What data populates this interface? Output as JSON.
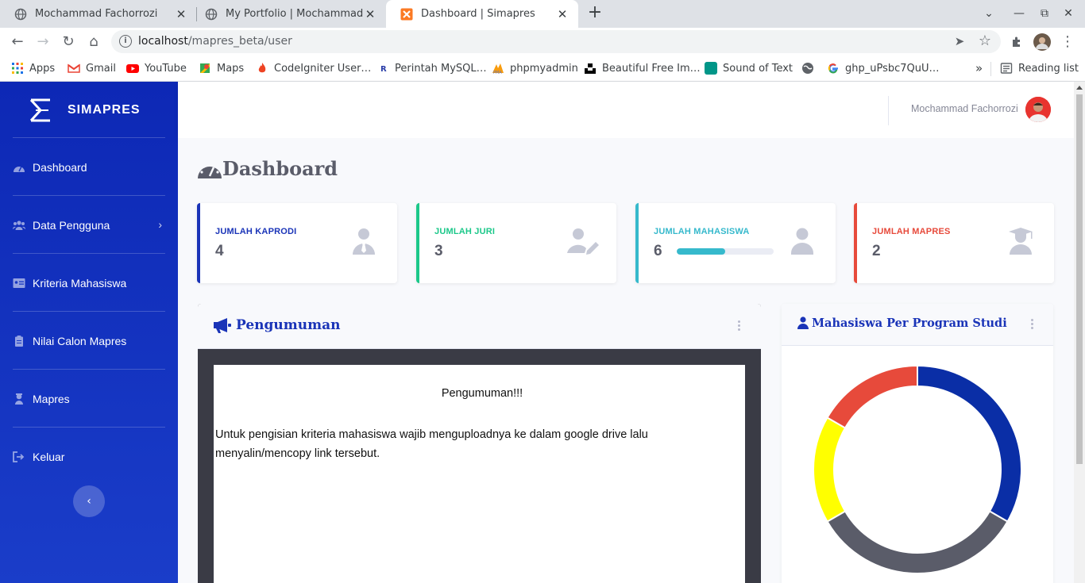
{
  "browser": {
    "tabs": [
      {
        "title": "Mochammad Fachorrozi",
        "active": false
      },
      {
        "title": "My Portfolio | Mochammad Fa",
        "active": false
      },
      {
        "title": "Dashboard | Simapres",
        "active": true
      }
    ],
    "url_host": "localhost",
    "url_path": "/mapres_beta/user",
    "bookmarks": [
      "Apps",
      "Gmail",
      "YouTube",
      "Maps",
      "CodeIgniter User…",
      "Perintah MySQL…",
      "phpmyadmin",
      "Beautiful Free Im…",
      "Sound of Text",
      "ghp_uPsbc7QuU…"
    ],
    "reading_list": "Reading list",
    "more_bookmarks": "»"
  },
  "sidebar": {
    "brand": "SIMAPRES",
    "items": [
      {
        "label": "Dashboard",
        "icon": "tachometer-icon"
      },
      {
        "label": "Data Pengguna",
        "icon": "users-icon",
        "has_submenu": true
      },
      {
        "label": "Kriteria Mahasiswa",
        "icon": "id-card-icon"
      },
      {
        "label": "Nilai Calon Mapres",
        "icon": "clipboard-icon"
      },
      {
        "label": "Mapres",
        "icon": "award-icon"
      },
      {
        "label": "Keluar",
        "icon": "sign-out-icon"
      }
    ],
    "toggle_symbol": "‹"
  },
  "topbar": {
    "user_name": "Mochammad Fachorrozi"
  },
  "page": {
    "title": "Dashboard"
  },
  "cards": [
    {
      "label": "JUMLAH KAPRODI",
      "value": "4",
      "color": "#1a34b8",
      "icon": "user-tie-icon"
    },
    {
      "label": "JUMLAH JURI",
      "value": "3",
      "color": "#1cc88a",
      "icon": "user-edit-icon"
    },
    {
      "label": "JUMLAH MAHASISWA",
      "value": "6",
      "color": "#36b9cc",
      "icon": "user-icon",
      "progress": 0.5
    },
    {
      "label": "JUMLAH MAPRES",
      "value": "2",
      "color": "#e74a3b",
      "icon": "user-graduate-icon"
    }
  ],
  "announcement": {
    "title": "Pengumuman",
    "heading": "Pengumuman!!!",
    "text": "Untuk pengisian kriteria mahasiswa wajib menguploadnya ke dalam google drive lalu menyalin/mencopy link tersebut."
  },
  "chart_panel": {
    "title": "Mahasiswa Per Program Studi"
  },
  "chart_data": {
    "type": "pie",
    "donut": true,
    "values": [
      2,
      2,
      1,
      1
    ],
    "colors": [
      "#0a2ea6",
      "#5a5c69",
      "#ffff00",
      "#e74a3b"
    ],
    "legend": "none"
  }
}
